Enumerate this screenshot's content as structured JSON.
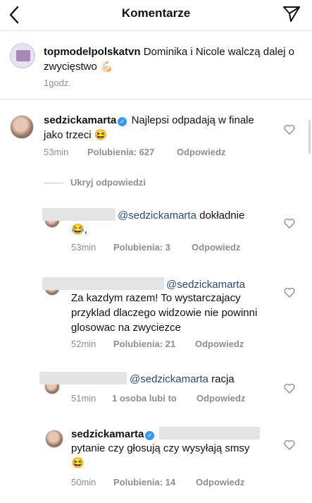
{
  "header": {
    "title": "Komentarze",
    "back_icon": "chevron-left-icon",
    "send_icon": "paper-plane-icon"
  },
  "caption": {
    "username": "topmodelpolskatvn",
    "text": "Dominika i Nicole walczą dalej o zwycięstwo",
    "emoji": "💪🏻",
    "time": "1godz."
  },
  "comments": [
    {
      "username": "sedzickamarta",
      "verified": true,
      "text": "Najlepsi odpadają w finale jako trzeci",
      "emoji": "😆",
      "time": "53min",
      "likes": "Polubienia: 627",
      "reply": "Odpowiedz"
    }
  ],
  "hide_replies": "Ukryj odpowiedzi",
  "replies": [
    {
      "mention": "@sedzickamarta",
      "text": "dokładnie",
      "emoji": "😂",
      "suffix": ",",
      "time": "53min",
      "likes": "Polubienia: 3",
      "reply": "Odpowiedz"
    },
    {
      "mention": "@sedzickamarta",
      "text": "Za kazdym razem! To wystarczajacy przyklad dlaczego widzowie nie powinni glosowac na zwyciezce",
      "time": "52min",
      "likes": "Polubienia: 21",
      "reply": "Odpowiedz"
    },
    {
      "mention": "@sedzickamarta",
      "text": "racja",
      "time": "51min",
      "likes": "1 osoba lubi to",
      "reply": "Odpowiedz"
    },
    {
      "username": "sedzickamarta",
      "verified": true,
      "text": "pytanie czy głosują czy wysyłają smsy",
      "emoji": "😆",
      "time": "50min",
      "likes": "Polubienia: 14",
      "reply": "Odpowiedz"
    }
  ]
}
